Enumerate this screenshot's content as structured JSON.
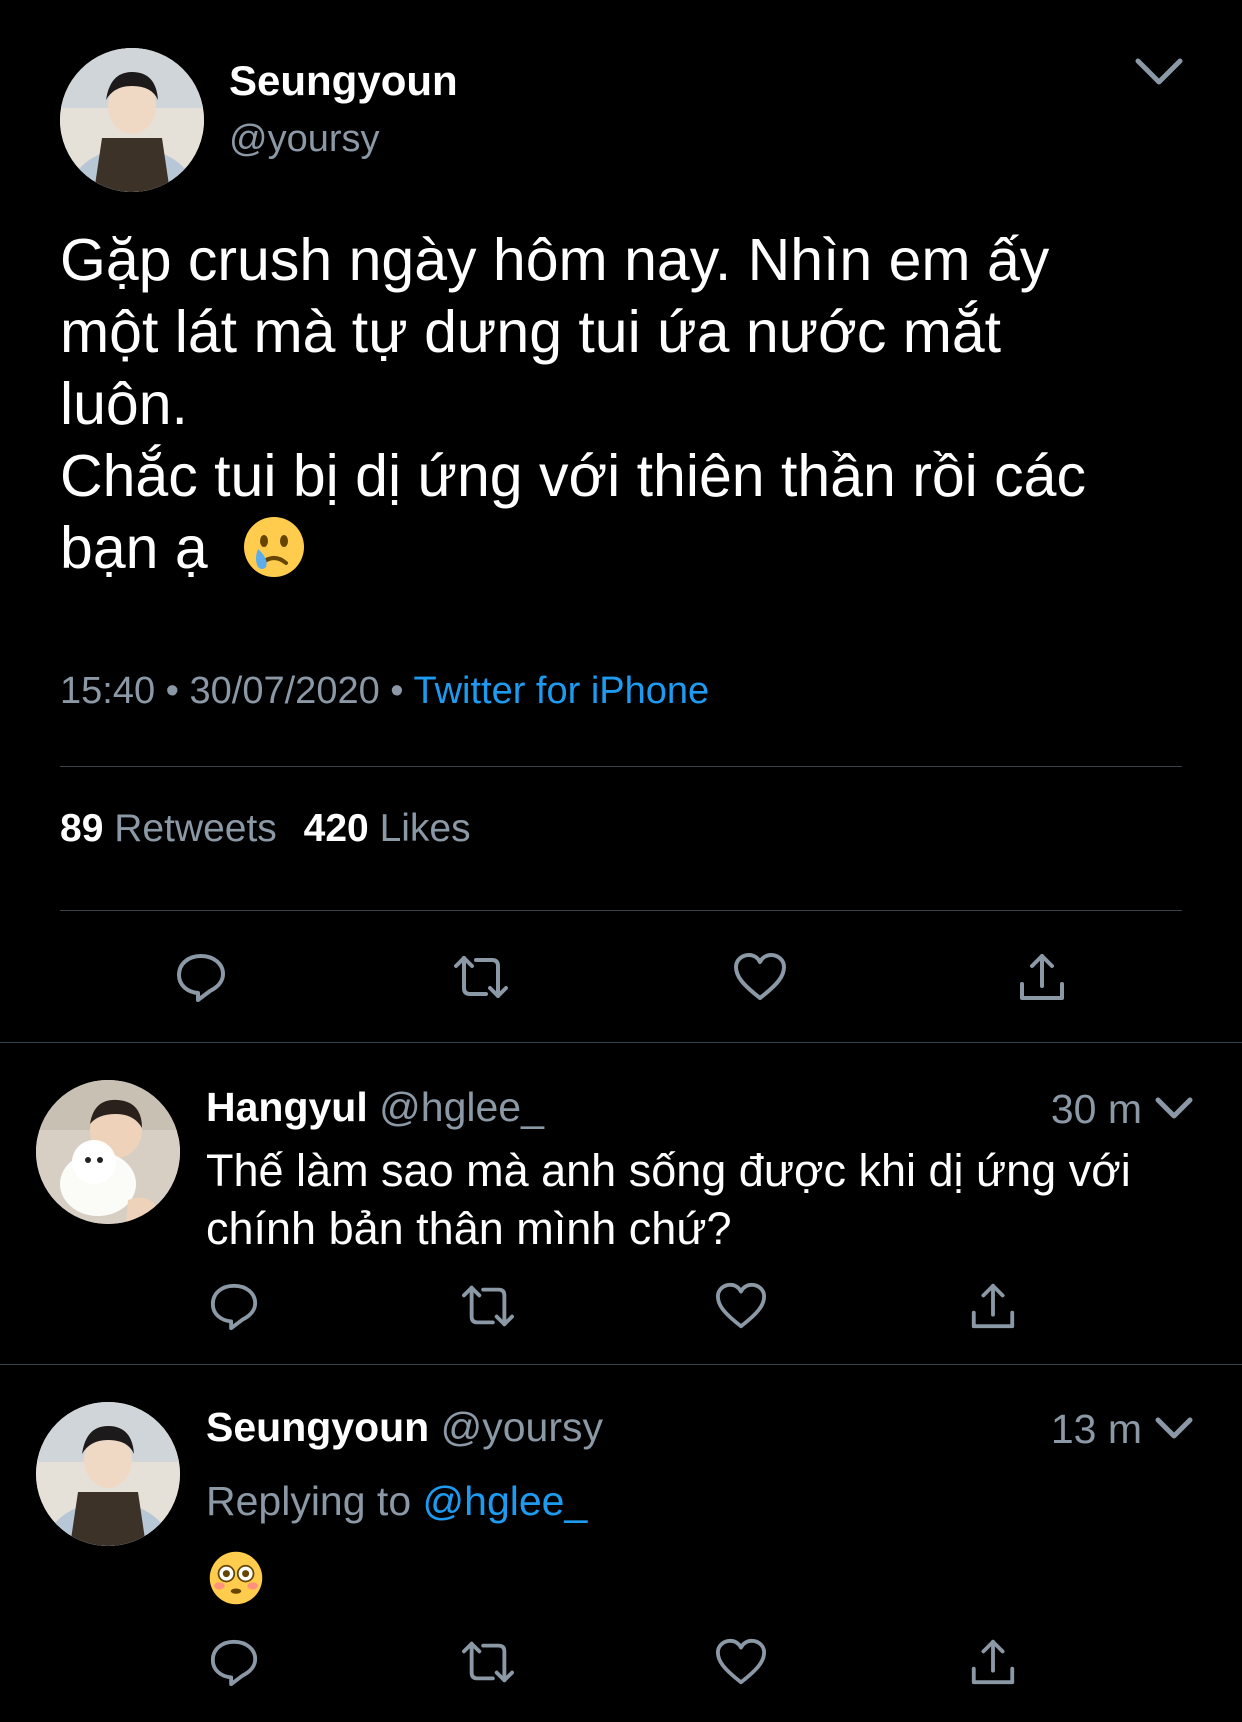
{
  "main_tweet": {
    "display_name": "Seungyoun",
    "handle": "@yoursy",
    "text_lines": [
      "Gặp crush ngày hôm nay. Nhìn em ấy",
      "một lát mà tự dưng tui ứa nước mắt",
      "luôn.",
      "Chắc tui bị dị ứng với thiên thần rồi các",
      "bạn ạ"
    ],
    "emoji": "crying-face",
    "time": "15:40",
    "date": "30/07/2020",
    "source": "Twitter for iPhone",
    "retweet_count": "89",
    "retweet_label": "Retweets",
    "like_count": "420",
    "like_label": "Likes"
  },
  "replies": [
    {
      "display_name": "Hangyul",
      "handle": "@hglee_",
      "age": "30 m",
      "text_lines": [
        "Thế làm sao mà anh sống được khi dị ứng với",
        "chính bản thân mình chứ?"
      ]
    },
    {
      "display_name": "Seungyoun",
      "handle": "@yoursy",
      "age": "13 m",
      "replying_label": "Replying to",
      "replying_handle": "@hglee_",
      "emoji": "flushed-face"
    }
  ],
  "colors": {
    "background": "#000000",
    "text": "#ffffff",
    "muted": "#8b98a5",
    "link": "#1d9bf0",
    "divider": "#38444d"
  },
  "icons": [
    "chevron-down-icon",
    "reply-icon",
    "retweet-icon",
    "like-icon",
    "share-icon"
  ]
}
